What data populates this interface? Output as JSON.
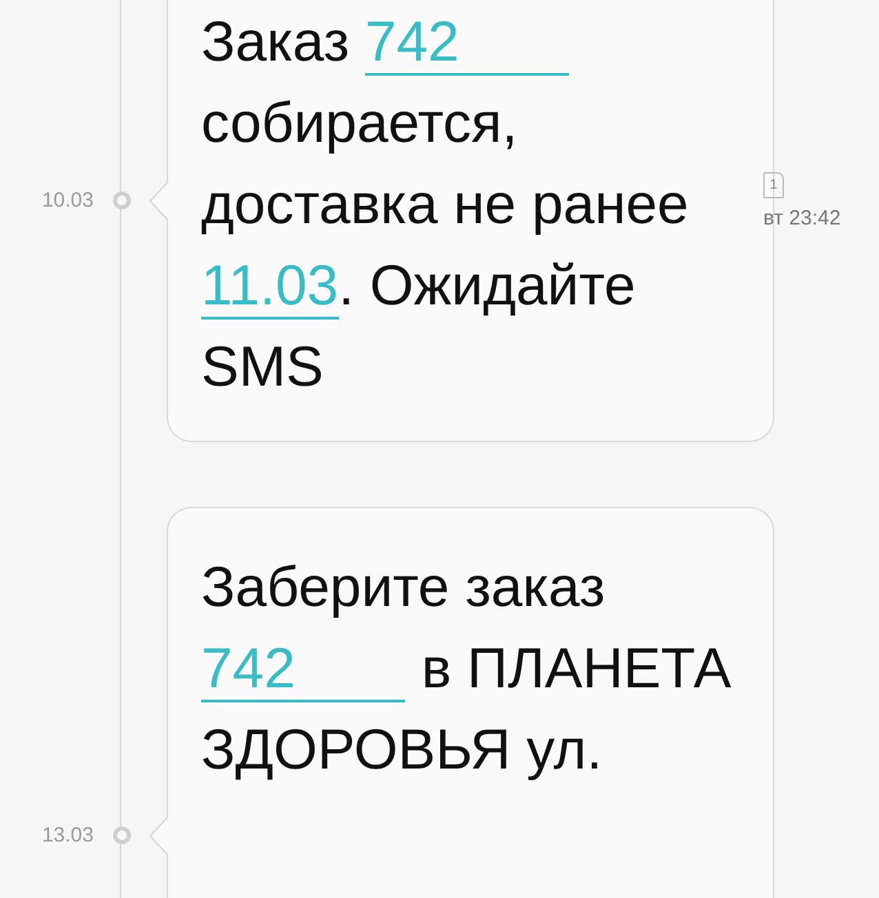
{
  "messages": [
    {
      "date": "10.03",
      "parts": [
        {
          "kind": "text",
          "text": "Заказ "
        },
        {
          "kind": "link",
          "text": "742",
          "redacted": true
        },
        {
          "kind": "text",
          "text": " собирается, доставка не ранее "
        },
        {
          "kind": "link",
          "text": "11.03",
          "redacted": false
        },
        {
          "kind": "text",
          "text": ". Ожидайте SMS"
        }
      ],
      "sim": "1",
      "time": "вт 23:42"
    },
    {
      "date": "13.03",
      "parts": [
        {
          "kind": "text",
          "text": "Заберите заказ "
        },
        {
          "kind": "link",
          "text": "742",
          "redacted": true
        },
        {
          "kind": "text",
          "text": " в ПЛАНЕТА ЗДОРОВЬЯ ул."
        }
      ]
    }
  ]
}
